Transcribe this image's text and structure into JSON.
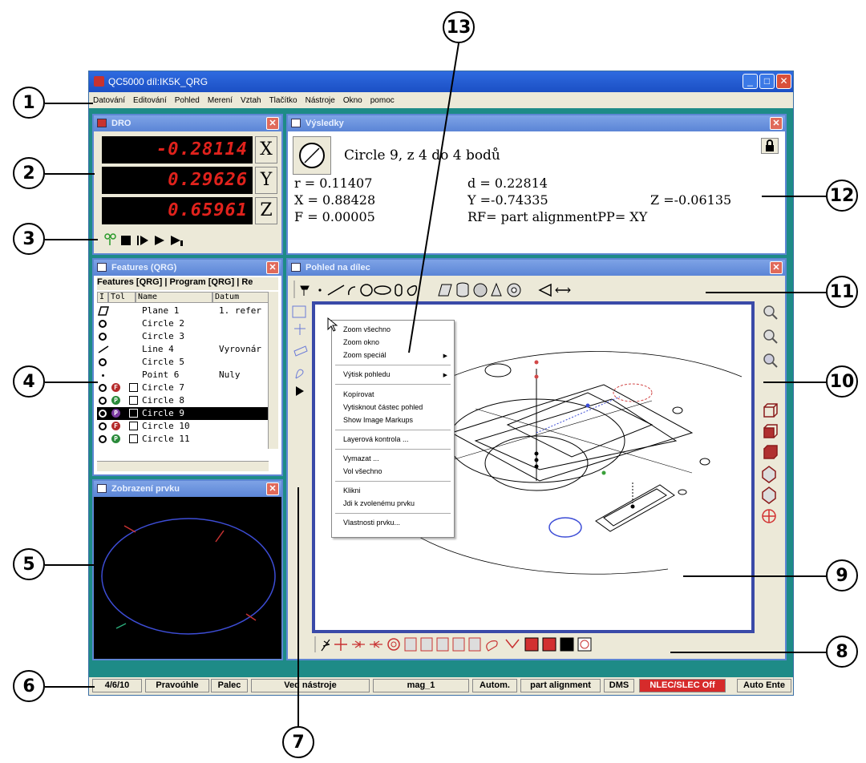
{
  "window": {
    "title": "QC5000 díl:IK5K_QRG",
    "minimize": "_",
    "maximize": "□",
    "close": "✕"
  },
  "menu": [
    "Datování",
    "Editování",
    "Pohled",
    "Merení",
    "Vztah",
    "Tlačítko",
    "Nástroje",
    "Okno",
    "pomoc"
  ],
  "dro": {
    "title": "DRO",
    "rows": [
      {
        "value": "-0.28114",
        "axis": "X"
      },
      {
        "value": "0.29626",
        "axis": "Y"
      },
      {
        "value": "0.65961",
        "axis": "Z"
      }
    ]
  },
  "results": {
    "title": "Výsledky",
    "heading": "Circle 9, z 4 do 4 bodů",
    "line1_left": "r = 0.11407",
    "line1_mid": "d = 0.22814",
    "line2_left": "X = 0.88428",
    "line2_mid": "Y =-0.74335",
    "line2_right": "Z =-0.06135",
    "line3_left": "F = 0.00005",
    "line3_mid": "RF= part alignmentPP= XY"
  },
  "features": {
    "title": "Features (QRG)",
    "tabs": "Features [QRG] | Program [QRG] | Re",
    "headers": [
      "I",
      "Tol",
      "Name",
      "Datum"
    ],
    "rows": [
      {
        "name": "Plane 1",
        "datum": "1. refer",
        "icon": "plane",
        "badge": "",
        "selected": false
      },
      {
        "name": "Circle 2",
        "datum": "",
        "icon": "circle",
        "badge": "",
        "selected": false
      },
      {
        "name": "Circle 3",
        "datum": "",
        "icon": "circle",
        "badge": "",
        "selected": false
      },
      {
        "name": "Line 4",
        "datum": "Vyrovnár",
        "icon": "line",
        "badge": "",
        "selected": false
      },
      {
        "name": "Circle 5",
        "datum": "",
        "icon": "circle",
        "badge": "",
        "selected": false
      },
      {
        "name": "Point 6",
        "datum": "Nuly",
        "icon": "point",
        "badge": "",
        "selected": false
      },
      {
        "name": "Circle 7",
        "datum": "",
        "icon": "circle",
        "badge": "F",
        "selected": false
      },
      {
        "name": "Circle 8",
        "datum": "",
        "icon": "circle",
        "badge": "P",
        "selected": false
      },
      {
        "name": "Circle 9",
        "datum": "",
        "icon": "circle",
        "badge": "P",
        "selected": true
      },
      {
        "name": "Circle 10",
        "datum": "",
        "icon": "circle",
        "badge": "F",
        "selected": false
      },
      {
        "name": "Circle 11",
        "datum": "",
        "icon": "circle",
        "badge": "P",
        "selected": false
      }
    ]
  },
  "feature_view": {
    "title": "Zobrazení prvku"
  },
  "part_view": {
    "title": "Pohled na dílec"
  },
  "context_menu": {
    "items": [
      "Zoom všechno",
      "Zoom okno",
      "Zoom speciál",
      "Výtisk pohledu",
      "Kopírovat",
      "Vytisknout částec pohled",
      "Show Image Markups",
      "Layerová kontrola ...",
      "Vymazat ...",
      "Vol všechno",
      "Klikni",
      "Jdi k zvolenému prvku",
      "Vlastnosti prvku..."
    ]
  },
  "status_bar": [
    "4/6/10",
    "Pravoúhle",
    "Palec",
    "Ved nástroje",
    "mag_1",
    "Autom.",
    "part alignment",
    "DMS",
    "NLEC/SLEC Off",
    "Auto Ente"
  ],
  "callouts": [
    "1",
    "2",
    "3",
    "4",
    "5",
    "6",
    "7",
    "8",
    "9",
    "10",
    "11",
    "12",
    "13"
  ],
  "colors": {
    "desktop_teal": "#1e8b87",
    "panel_title": "#5b85d6",
    "dro_red": "#e0221c",
    "status_alert": "#d62b2b"
  }
}
